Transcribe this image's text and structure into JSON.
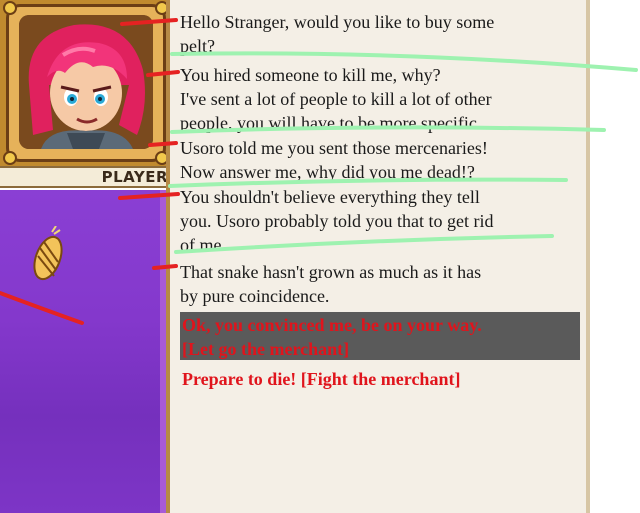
{
  "player": {
    "name_label": "PLAYER"
  },
  "dialogue": [
    {
      "speaker": "merchant",
      "line1": "Hello Stranger, would you like to buy some",
      "line2": "pelt?"
    },
    {
      "speaker": "player",
      "line1": "You hired someone to kill me, why?"
    },
    {
      "speaker": "merchant",
      "line1": "I've sent a lot of people to kill a lot of other",
      "line2": "people, you will have to be more specific"
    },
    {
      "speaker": "player",
      "line1": "Usoro told me you sent those mercenaries!",
      "line2": "Now answer me, why did you me dead!?"
    },
    {
      "speaker": "merchant",
      "line1": "You shouldn't believe everything they tell",
      "line2": "you. Usoro probably told you that to get rid",
      "line3": "of me."
    },
    {
      "speaker": "merchant",
      "line1": "That snake hasn't grown as much as it has",
      "line2": "by pure coincidence."
    }
  ],
  "choices": [
    {
      "line1": "Ok, you convinced me, be on your way.",
      "line2": "[Let go the merchant]",
      "highlighted": true
    },
    {
      "line1": "Prepare to die! [Fight the merchant]",
      "highlighted": false
    }
  ],
  "colors": {
    "choice_text": "#e0141c",
    "choice_highlight_bg": "#5a5a5a",
    "panel_bg": "#f4efe6",
    "world_bg": "#8438cc",
    "annotation_red": "#e52222",
    "annotation_green": "#9ef2b0"
  }
}
